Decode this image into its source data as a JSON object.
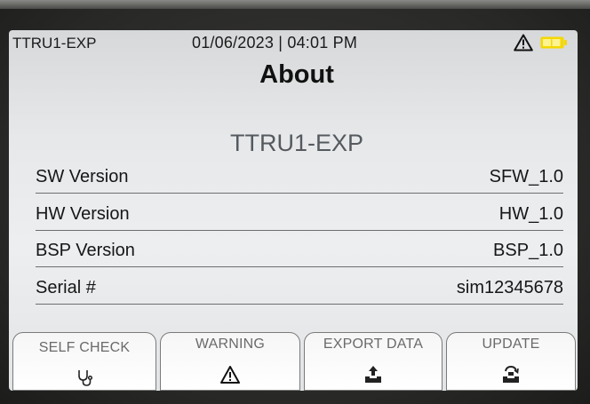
{
  "status_bar": {
    "device_name": "TTRU1-EXP",
    "datetime": "01/06/2023 | 04:01 PM",
    "icons": [
      "warning-icon",
      "battery-icon"
    ],
    "battery_color": "#f5d800"
  },
  "page": {
    "title": "About",
    "device_name": "TTRU1-EXP"
  },
  "info": {
    "rows": [
      {
        "label": "SW Version",
        "value": "SFW_1.0"
      },
      {
        "label": "HW Version",
        "value": "HW_1.0"
      },
      {
        "label": "BSP Version",
        "value": "BSP_1.0"
      },
      {
        "label": "Serial #",
        "value": "sim12345678"
      }
    ]
  },
  "softkeys": [
    {
      "label": "SELF CHECK",
      "icon": "stethoscope-icon"
    },
    {
      "label": "WARNING",
      "icon": "warning-icon"
    },
    {
      "label": "EXPORT DATA",
      "icon": "export-upload-icon"
    },
    {
      "label": "UPDATE",
      "icon": "update-icon"
    }
  ]
}
